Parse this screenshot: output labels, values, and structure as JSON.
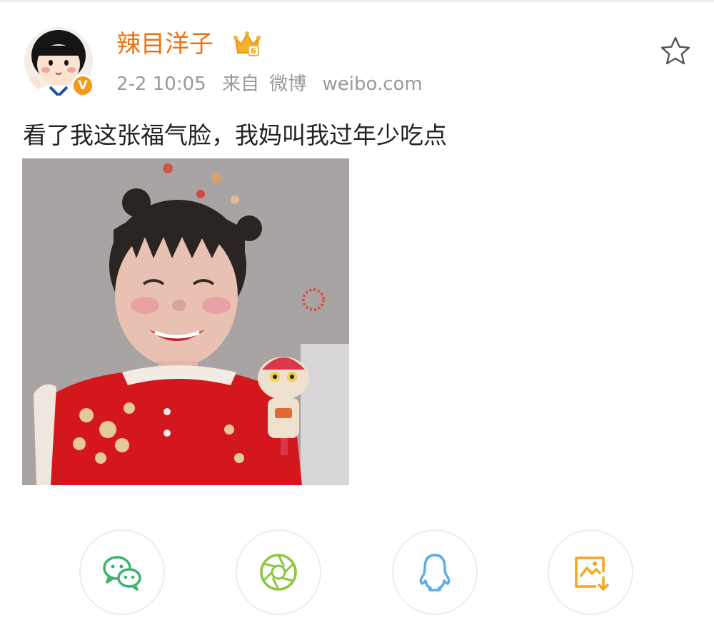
{
  "post": {
    "username": "辣目洋子",
    "date": "2-2 10:05",
    "source_prefix": "来自",
    "source_name": "微博",
    "source_domain": "weibo.com",
    "text": "看了我这张福气脸，我妈叫我过年少吃点"
  },
  "badges": {
    "verified_mark": "V",
    "crown_level": "6"
  },
  "icons": {
    "favorite": "star-outline-icon",
    "crown": "crown-icon",
    "verified": "verified-v-icon"
  },
  "share": [
    {
      "name": "wechat",
      "icon": "wechat-icon",
      "color": "#3cb371"
    },
    {
      "name": "moments",
      "icon": "moments-shutter-icon",
      "color": "#8cc63f"
    },
    {
      "name": "qq",
      "icon": "qq-penguin-icon",
      "color": "#5aaee6"
    },
    {
      "name": "save-image",
      "icon": "save-image-icon",
      "color": "#f5a623"
    }
  ],
  "colors": {
    "username": "#eb7315",
    "meta": "#9a9a9a",
    "text": "#222222",
    "verified": "#f29a16"
  }
}
